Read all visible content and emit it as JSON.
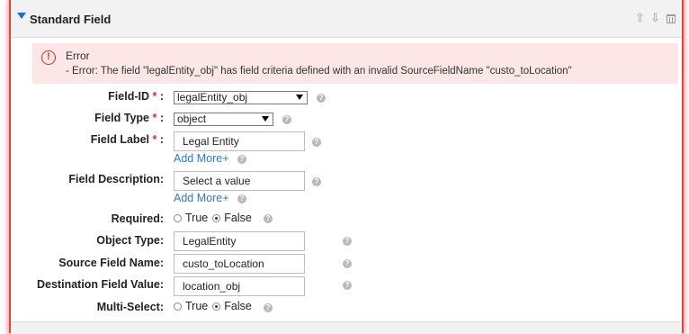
{
  "panel": {
    "title": "Standard Field",
    "icons": [
      "collapse-icon",
      "move-up-icon",
      "move-down-icon",
      "trash-icon"
    ]
  },
  "error": {
    "title": "Error",
    "message": "- Error: The field \"legalEntity_obj\" has field criteria defined with an invalid SourceFieldName \"custo_toLocation\""
  },
  "fields": {
    "field_id": {
      "label": "Field-ID",
      "required_mark": "*",
      "colon": " :",
      "value": "legalEntity_obj"
    },
    "field_type": {
      "label": "Field Type",
      "required_mark": "*",
      "colon": " :",
      "value": "object"
    },
    "field_label": {
      "label": "Field Label",
      "required_mark": "*",
      "colon": " :",
      "value": "Legal Entity",
      "add_more": "Add More+"
    },
    "field_description": {
      "label": "Field Description:",
      "value": "Select a value",
      "add_more": "Add More+"
    },
    "required": {
      "label": "Required:",
      "option_true": "True",
      "option_false": "False",
      "selected": "False"
    },
    "object_type": {
      "label": "Object Type:",
      "value": "LegalEntity"
    },
    "source_field_name": {
      "label": "Source Field Name:",
      "value": "custo_toLocation"
    },
    "destination_field_value": {
      "label": "Destination Field Value:",
      "value": "location_obj"
    },
    "multi_select": {
      "label": "Multi-Select:",
      "option_true": "True",
      "option_false": "False",
      "selected": "False"
    }
  },
  "help_glyph": "?",
  "colors": {
    "highlight_border": "#e8413b",
    "error_background": "#fce6e6",
    "required_star": "#d0312d",
    "link": "#2a7ac8",
    "collapse_triangle": "#1f6fc5"
  }
}
